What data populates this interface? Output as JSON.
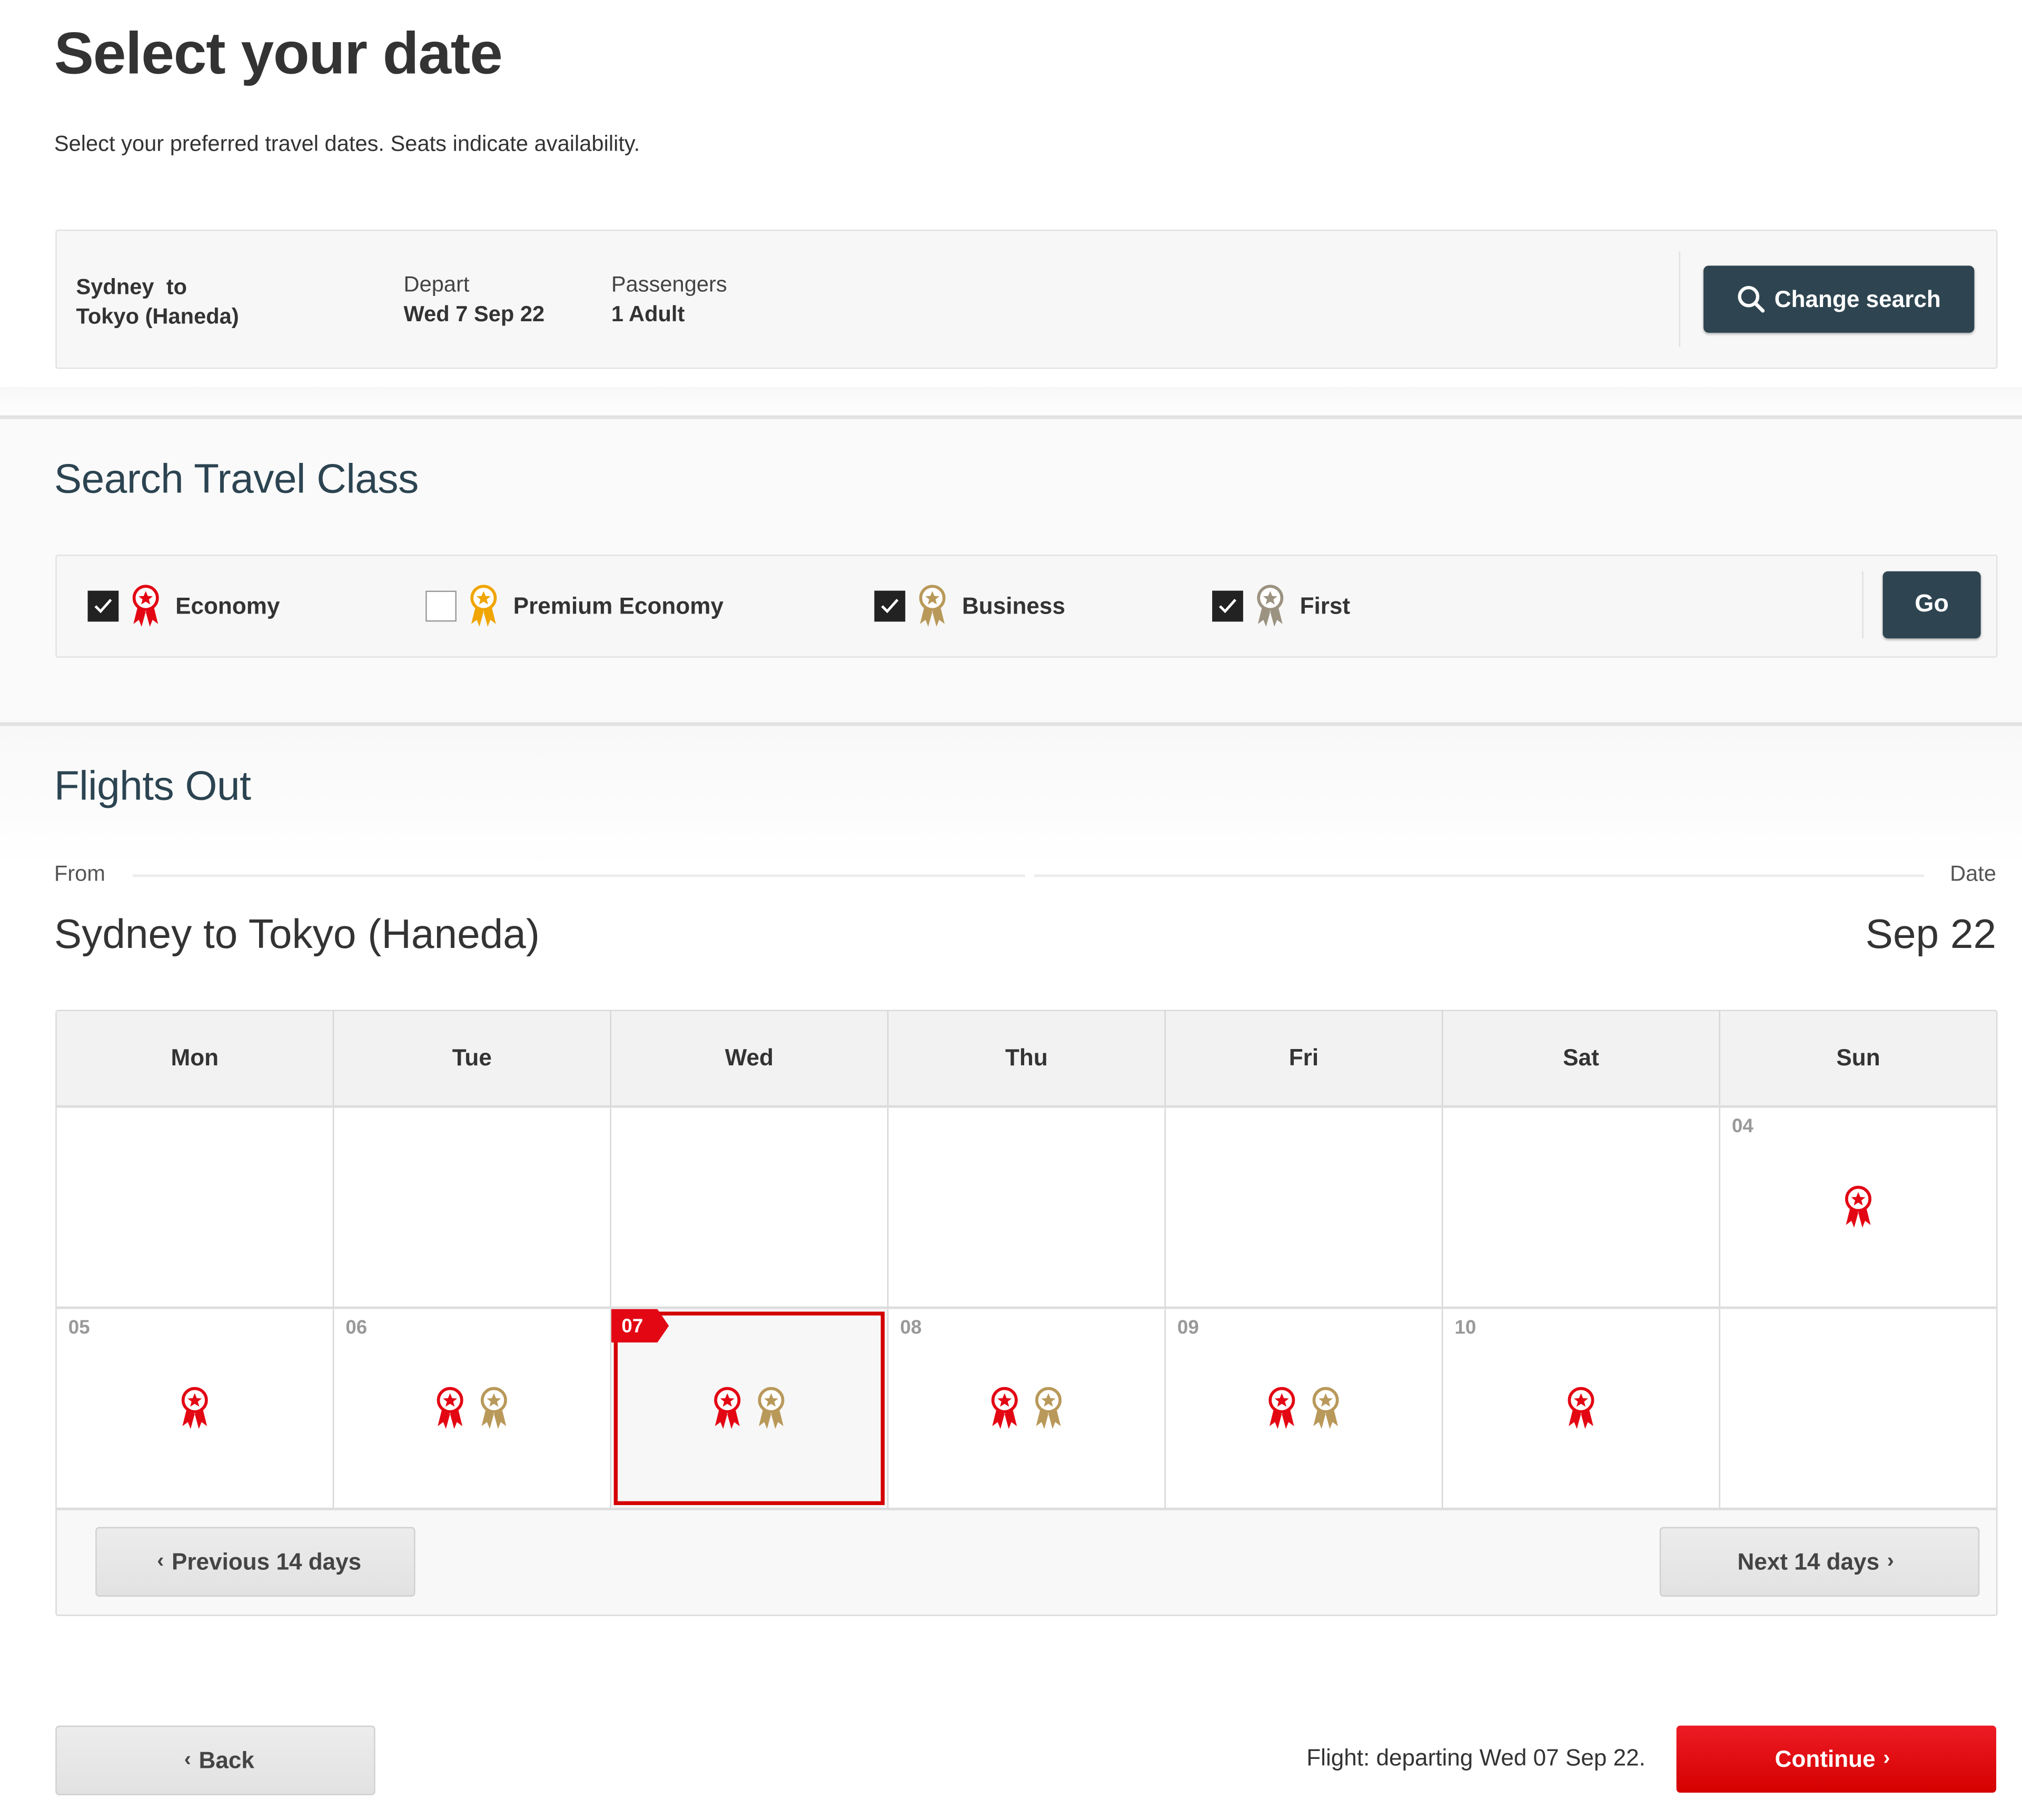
{
  "page": {
    "title": "Select your date",
    "subtitle": "Select your preferred travel dates. Seats indicate availability."
  },
  "summary": {
    "route_line1": "Sydney  to",
    "route_line2": "Tokyo (Haneda)",
    "depart_label": "Depart",
    "depart_value": "Wed 7 Sep 22",
    "passengers_label": "Passengers",
    "passengers_value": "1 Adult",
    "change_search_label": "Change search",
    "change_search_icon": "search-icon"
  },
  "travel_class": {
    "title": "Search Travel Class",
    "go_label": "Go",
    "classes": [
      {
        "name": "Economy",
        "checked": true,
        "color": "#e30613"
      },
      {
        "name": "Premium Economy",
        "checked": false,
        "color": "#f0a500"
      },
      {
        "name": "Business",
        "checked": true,
        "color": "#b9995a"
      },
      {
        "name": "First",
        "checked": true,
        "color": "#9c9281"
      }
    ]
  },
  "flights_out": {
    "title": "Flights Out",
    "from_label": "From",
    "date_label": "Date",
    "route": "Sydney to Tokyo (Haneda)",
    "month": "Sep 22",
    "weekdays": [
      "Mon",
      "Tue",
      "Wed",
      "Thu",
      "Fri",
      "Sat",
      "Sun"
    ],
    "weeks": [
      [
        {
          "day": "",
          "classes": []
        },
        {
          "day": "",
          "classes": []
        },
        {
          "day": "",
          "classes": []
        },
        {
          "day": "",
          "classes": []
        },
        {
          "day": "",
          "classes": []
        },
        {
          "day": "",
          "classes": []
        },
        {
          "day": "04",
          "classes": [
            "Economy"
          ]
        }
      ],
      [
        {
          "day": "05",
          "classes": [
            "Economy"
          ]
        },
        {
          "day": "06",
          "classes": [
            "Economy",
            "Business"
          ]
        },
        {
          "day": "07",
          "classes": [
            "Economy",
            "Business"
          ],
          "selected": true
        },
        {
          "day": "08",
          "classes": [
            "Economy",
            "Business"
          ]
        },
        {
          "day": "09",
          "classes": [
            "Economy",
            "Business"
          ]
        },
        {
          "day": "10",
          "classes": [
            "Economy"
          ]
        },
        {
          "day": "",
          "classes": []
        }
      ]
    ],
    "prev_label": "Previous 14 days",
    "next_label": "Next 14 days"
  },
  "footer": {
    "back_label": "Back",
    "flight_summary": "Flight: departing Wed 07 Sep 22.",
    "continue_label": "Continue"
  },
  "colors": {
    "brand_red": "#e30613",
    "dark_button": "#2e4551",
    "heading_blue": "#2c4451"
  }
}
